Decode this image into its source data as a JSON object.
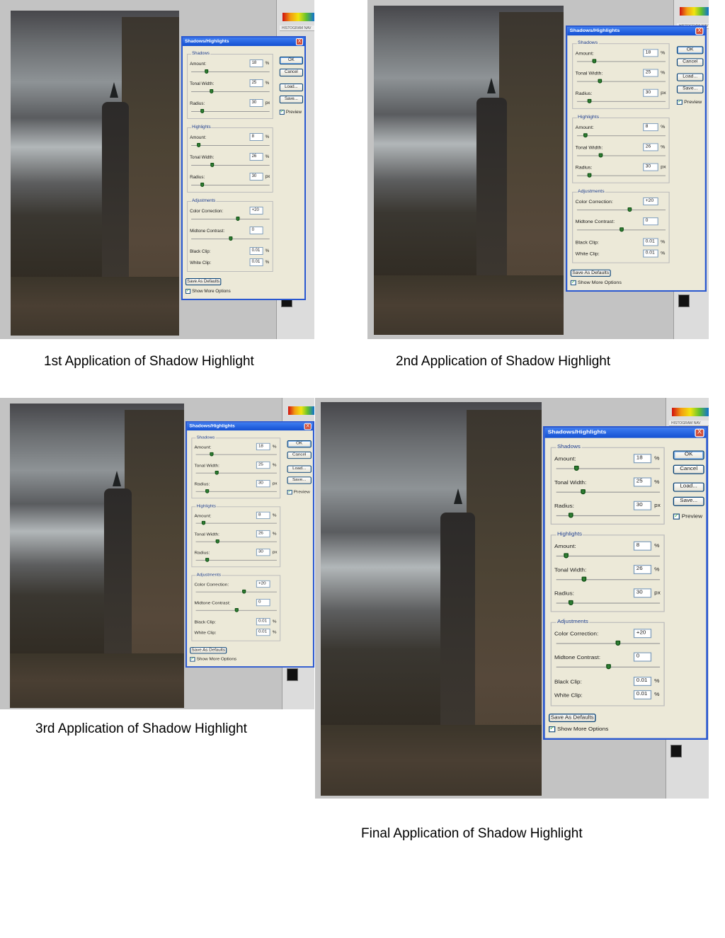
{
  "captions": [
    "1st Application of Shadow Highlight",
    "2nd Application of Shadow Highlight",
    "3rd Application of Shadow Highlight",
    "Final Application of Shadow Highlight"
  ],
  "dialog": {
    "title": "Shadows/Highlights",
    "close_glyph": "X",
    "shadows_label": "Shadows",
    "highlights_label": "Highlights",
    "adjustments_label": "Adjustments",
    "shadows": [
      {
        "label": "Amount:",
        "value": "18",
        "unit": "%",
        "slider": 0.18
      },
      {
        "label": "Tonal Width:",
        "value": "25",
        "unit": "%",
        "slider": 0.25
      },
      {
        "label": "Radius:",
        "value": "30",
        "unit": "px",
        "slider": 0.12
      }
    ],
    "highlights": [
      {
        "label": "Amount:",
        "value": "8",
        "unit": "%",
        "slider": 0.08
      },
      {
        "label": "Tonal Width:",
        "value": "26",
        "unit": "%",
        "slider": 0.26
      },
      {
        "label": "Radius:",
        "value": "30",
        "unit": "px",
        "slider": 0.12
      }
    ],
    "adjustments": {
      "color_correction_label": "Color Correction:",
      "color_correction_value": "+20",
      "color_correction_slider": 0.6,
      "midtone_contrast_label": "Midtone Contrast:",
      "midtone_contrast_value": "0",
      "midtone_contrast_slider": 0.5,
      "black_clip_label": "Black Clip:",
      "black_clip_value": "0.01",
      "white_clip_label": "White Clip:",
      "white_clip_value": "0.01",
      "clip_unit": "%"
    },
    "buttons": {
      "ok": "OK",
      "cancel": "Cancel",
      "load": "Load...",
      "save": "Save..."
    },
    "preview_label": "Preview",
    "preview_checked": true,
    "save_defaults": "Save As Defaults",
    "show_more_label": "Show More Options",
    "show_more_checked": true
  },
  "side_panel": {
    "histogram_label": "HISTOGRAM   NAV"
  },
  "colors": {
    "titlebar": "#1450d2",
    "dialog_bg": "#ece9d8",
    "caption_text": "#000000"
  }
}
